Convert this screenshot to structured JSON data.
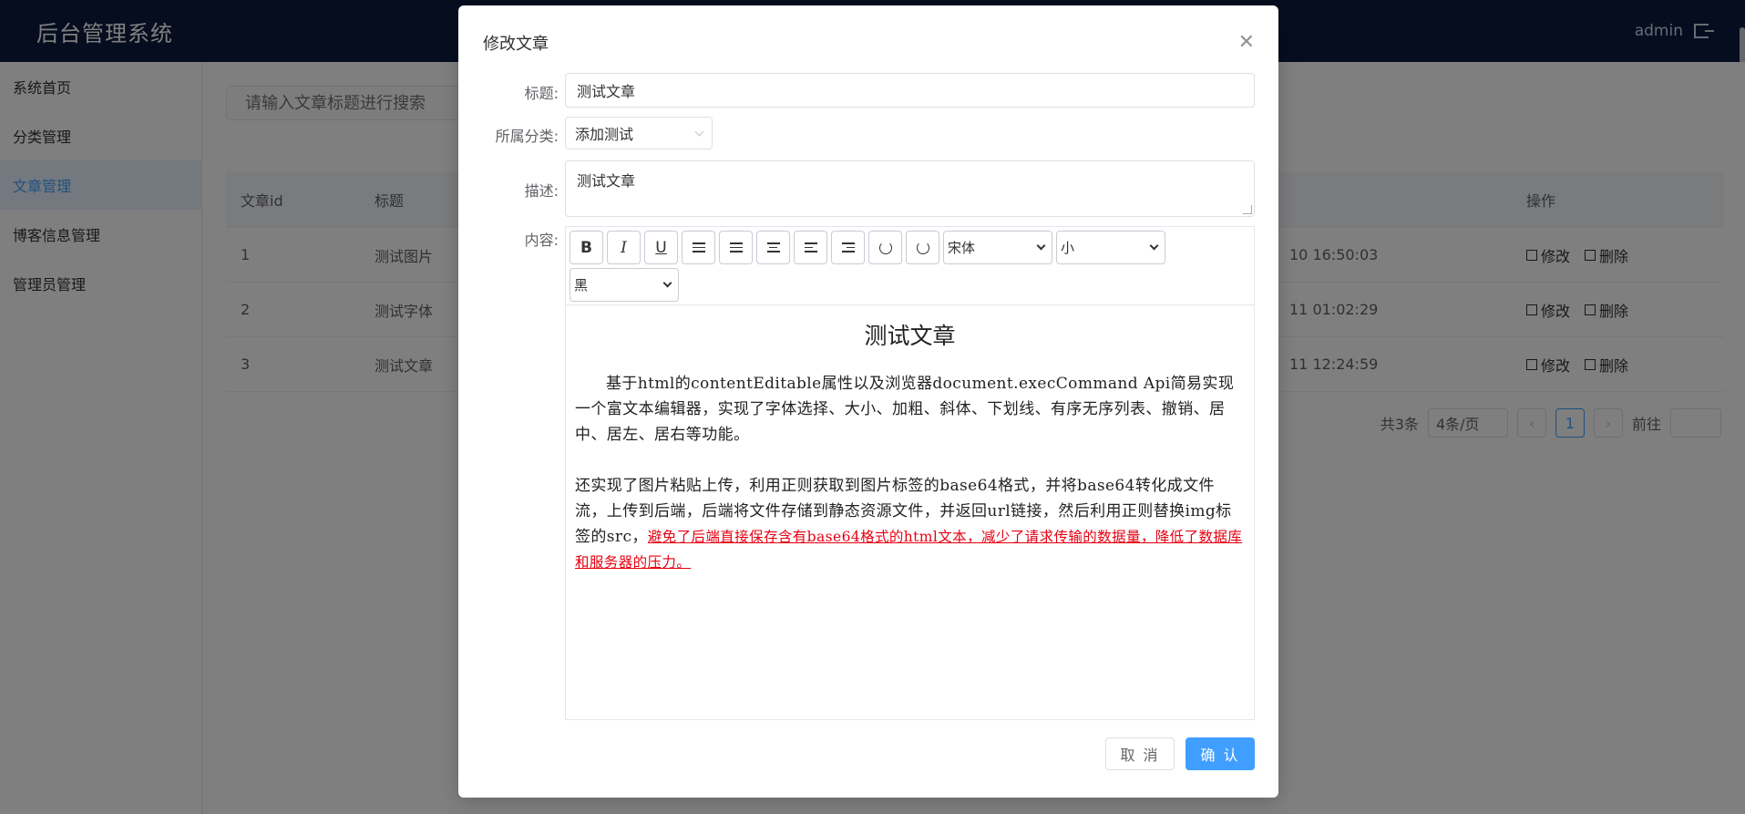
{
  "header": {
    "title": "后台管理系统",
    "user": "admin"
  },
  "sidebar": {
    "items": [
      {
        "label": "系统首页"
      },
      {
        "label": "分类管理"
      },
      {
        "label": "文章管理",
        "active": true
      },
      {
        "label": "博客信息管理"
      },
      {
        "label": "管理员管理"
      }
    ]
  },
  "main": {
    "search_placeholder": "请输入文章标题进行搜索",
    "table": {
      "headers": {
        "id": "文章id",
        "title": "标题",
        "op": "操作"
      },
      "rows": [
        {
          "id": "1",
          "title": "测试图片",
          "time": "10 16:50:03"
        },
        {
          "id": "2",
          "title": "测试字体",
          "time": "11 01:02:29"
        },
        {
          "id": "3",
          "title": "测试文章",
          "time": "11 12:24:59"
        }
      ],
      "edit_label": "修改",
      "delete_label": "删除"
    },
    "pager": {
      "total": "共3条",
      "size": "4条/页",
      "page": "1",
      "goto": "前往"
    }
  },
  "dialog": {
    "title": "修改文章",
    "labels": {
      "title": "标题:",
      "category": "所属分类:",
      "desc": "描述:",
      "content": "内容:"
    },
    "title_value": "测试文章",
    "category_value": "添加测试",
    "desc_value": "测试文章",
    "toolbar": {
      "bold": "B",
      "italic": "I",
      "underline": "U",
      "font": "宋体",
      "size": "小",
      "color": "黑"
    },
    "content": {
      "heading": "测试文章",
      "p1": "基于html的contentEditable属性以及浏览器document.execCommand Api简易实现一个富文本编辑器，实现了字体选择、大小、加粗、斜体、下划线、有序无序列表、撤销、居中、居左、居右等功能。",
      "p2_plain": "还实现了图片粘贴上传，利用正则获取到图片标签的base64格式，并将base64转化成文件流，上传到后端，后端将文件存储到静态资源文件，并返回url链接，然后利用正则替换img标签的src，",
      "p2_red": "避免了后端直接保存含有base64格式的html文本，减少了请求传输的数据量，降低了数据库和服务器的压力。"
    },
    "cancel_label": "取 消",
    "ok_label": "确 认"
  },
  "colors": {
    "header_bg": "#0b1b3f",
    "primary": "#409eff",
    "red_text": "#e60012"
  }
}
